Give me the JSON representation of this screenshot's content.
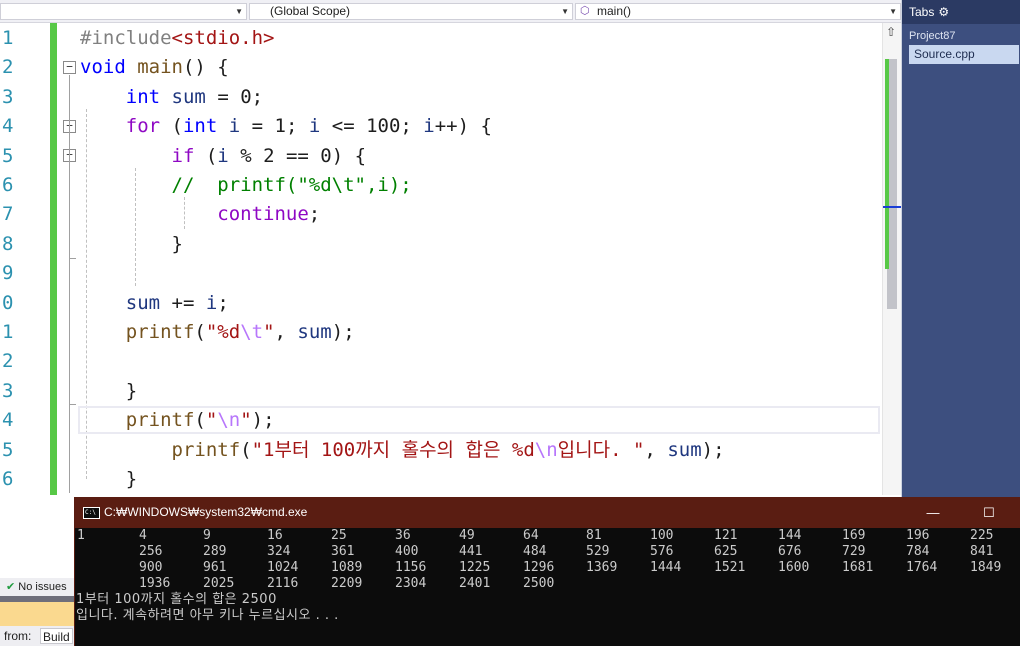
{
  "navbar": {
    "file_dropdown": "",
    "scope_dropdown": "(Global Scope)",
    "function_dropdown": "main()"
  },
  "editor": {
    "line_numbers": [
      "1",
      "2",
      "3",
      "4",
      "5",
      "6",
      "7",
      "8",
      "9",
      "0",
      "1",
      "2",
      "3",
      "4",
      "5",
      "6"
    ],
    "lines": [
      [
        {
          "t": "#include",
          "c": "#808080"
        },
        {
          "t": "<stdio.h>",
          "c": "#a31515"
        }
      ],
      [
        {
          "t": "void",
          "c": "#0000ff"
        },
        {
          "t": " ",
          "c": "#1e1e1e"
        },
        {
          "t": "main",
          "c": "#74531f"
        },
        {
          "t": "() {",
          "c": "#1e1e1e"
        }
      ],
      [
        {
          "t": "    ",
          "c": "#1e1e1e"
        },
        {
          "t": "int",
          "c": "#0000ff"
        },
        {
          "t": " ",
          "c": "#1e1e1e"
        },
        {
          "t": "sum",
          "c": "#1f377f"
        },
        {
          "t": " = 0;",
          "c": "#1e1e1e"
        }
      ],
      [
        {
          "t": "    ",
          "c": "#1e1e1e"
        },
        {
          "t": "for",
          "c": "#8f08c4"
        },
        {
          "t": " (",
          "c": "#1e1e1e"
        },
        {
          "t": "int",
          "c": "#0000ff"
        },
        {
          "t": " ",
          "c": "#1e1e1e"
        },
        {
          "t": "i",
          "c": "#1f377f"
        },
        {
          "t": " = 1; ",
          "c": "#1e1e1e"
        },
        {
          "t": "i",
          "c": "#1f377f"
        },
        {
          "t": " <= 100; ",
          "c": "#1e1e1e"
        },
        {
          "t": "i",
          "c": "#1f377f"
        },
        {
          "t": "++) {",
          "c": "#1e1e1e"
        }
      ],
      [
        {
          "t": "        ",
          "c": "#1e1e1e"
        },
        {
          "t": "if",
          "c": "#8f08c4"
        },
        {
          "t": " (",
          "c": "#1e1e1e"
        },
        {
          "t": "i",
          "c": "#1f377f"
        },
        {
          "t": " % 2 == 0) {",
          "c": "#1e1e1e"
        }
      ],
      [
        {
          "t": "        ",
          "c": "#1e1e1e"
        },
        {
          "t": "//  printf(\"%d\\t\",i);",
          "c": "#008000"
        }
      ],
      [
        {
          "t": "            ",
          "c": "#1e1e1e"
        },
        {
          "t": "continue",
          "c": "#8f08c4"
        },
        {
          "t": ";",
          "c": "#1e1e1e"
        }
      ],
      [
        {
          "t": "        }",
          "c": "#1e1e1e"
        }
      ],
      [
        {
          "t": "",
          "c": "#1e1e1e"
        }
      ],
      [
        {
          "t": "    ",
          "c": "#1e1e1e"
        },
        {
          "t": "sum",
          "c": "#1f377f"
        },
        {
          "t": " += ",
          "c": "#1e1e1e"
        },
        {
          "t": "i",
          "c": "#1f377f"
        },
        {
          "t": ";",
          "c": "#1e1e1e"
        }
      ],
      [
        {
          "t": "    ",
          "c": "#1e1e1e"
        },
        {
          "t": "printf",
          "c": "#74531f"
        },
        {
          "t": "(",
          "c": "#1e1e1e"
        },
        {
          "t": "\"%d",
          "c": "#a31515"
        },
        {
          "t": "\\t",
          "c": "#b776fb"
        },
        {
          "t": "\"",
          "c": "#a31515"
        },
        {
          "t": ", ",
          "c": "#1e1e1e"
        },
        {
          "t": "sum",
          "c": "#1f377f"
        },
        {
          "t": ");",
          "c": "#1e1e1e"
        }
      ],
      [
        {
          "t": "",
          "c": "#1e1e1e"
        }
      ],
      [
        {
          "t": "    }",
          "c": "#1e1e1e"
        }
      ],
      [
        {
          "t": "    ",
          "c": "#1e1e1e"
        },
        {
          "t": "printf",
          "c": "#74531f"
        },
        {
          "t": "(",
          "c": "#1e1e1e"
        },
        {
          "t": "\"",
          "c": "#a31515"
        },
        {
          "t": "\\n",
          "c": "#b776fb"
        },
        {
          "t": "\"",
          "c": "#a31515"
        },
        {
          "t": ");",
          "c": "#1e1e1e"
        }
      ],
      [
        {
          "t": "        ",
          "c": "#1e1e1e"
        },
        {
          "t": "printf",
          "c": "#74531f"
        },
        {
          "t": "(",
          "c": "#1e1e1e"
        },
        {
          "t": "\"1부터 100까지 홀수의 합은 %d",
          "c": "#a31515"
        },
        {
          "t": "\\n",
          "c": "#b776fb"
        },
        {
          "t": "입니다. \"",
          "c": "#a31515"
        },
        {
          "t": ", ",
          "c": "#1e1e1e"
        },
        {
          "t": "sum",
          "c": "#1f377f"
        },
        {
          "t": ");",
          "c": "#1e1e1e"
        }
      ],
      [
        {
          "t": "    }",
          "c": "#1e1e1e"
        }
      ]
    ]
  },
  "tabs_panel": {
    "title": "Tabs",
    "project": "Project87",
    "active_file": "Source.cpp"
  },
  "status": {
    "issues": "No issues",
    "output_from": "from:",
    "output_source": "Build"
  },
  "console": {
    "title": "C:₩WINDOWS₩system32₩cmd.exe",
    "minimize": "—",
    "maximize": "☐",
    "number_rows": [
      [
        "1",
        "4",
        "9",
        "16",
        "25",
        "36",
        "49",
        "64",
        "81",
        "100",
        "121",
        "144",
        "169",
        "196",
        "225"
      ],
      [
        "",
        "256",
        "289",
        "324",
        "361",
        "400",
        "441",
        "484",
        "529",
        "576",
        "625",
        "676",
        "729",
        "784",
        "841"
      ],
      [
        "",
        "900",
        "961",
        "1024",
        "1089",
        "1156",
        "1225",
        "1296",
        "1369",
        "1444",
        "1521",
        "1600",
        "1681",
        "1764",
        "1849"
      ],
      [
        "",
        "1936",
        "2025",
        "2116",
        "2209",
        "2304",
        "2401",
        "2500"
      ]
    ],
    "result_line": "1부터 100까지 홀수의 합은 2500",
    "prompt_line": "입니다. 계속하려면 아무 키나 누르십시오 . . ."
  }
}
